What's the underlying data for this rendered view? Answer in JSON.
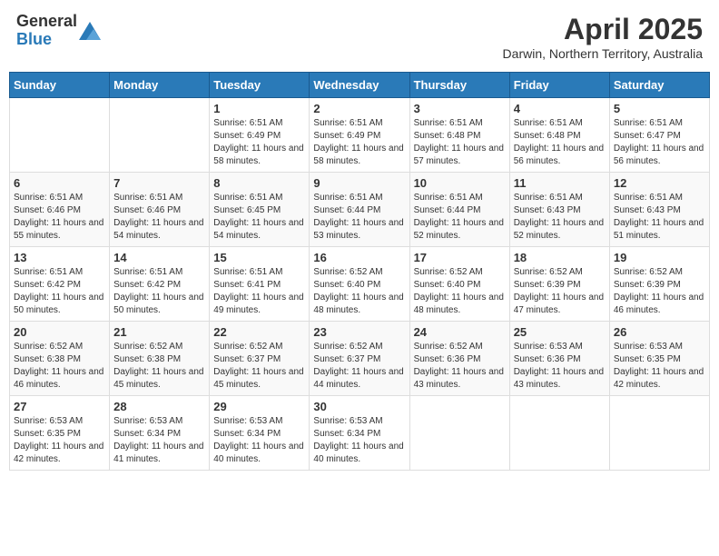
{
  "header": {
    "logo_general": "General",
    "logo_blue": "Blue",
    "title": "April 2025",
    "subtitle": "Darwin, Northern Territory, Australia"
  },
  "calendar": {
    "weekdays": [
      "Sunday",
      "Monday",
      "Tuesday",
      "Wednesday",
      "Thursday",
      "Friday",
      "Saturday"
    ],
    "weeks": [
      [
        {
          "day": "",
          "info": ""
        },
        {
          "day": "",
          "info": ""
        },
        {
          "day": "1",
          "info": "Sunrise: 6:51 AM\nSunset: 6:49 PM\nDaylight: 11 hours and 58 minutes."
        },
        {
          "day": "2",
          "info": "Sunrise: 6:51 AM\nSunset: 6:49 PM\nDaylight: 11 hours and 58 minutes."
        },
        {
          "day": "3",
          "info": "Sunrise: 6:51 AM\nSunset: 6:48 PM\nDaylight: 11 hours and 57 minutes."
        },
        {
          "day": "4",
          "info": "Sunrise: 6:51 AM\nSunset: 6:48 PM\nDaylight: 11 hours and 56 minutes."
        },
        {
          "day": "5",
          "info": "Sunrise: 6:51 AM\nSunset: 6:47 PM\nDaylight: 11 hours and 56 minutes."
        }
      ],
      [
        {
          "day": "6",
          "info": "Sunrise: 6:51 AM\nSunset: 6:46 PM\nDaylight: 11 hours and 55 minutes."
        },
        {
          "day": "7",
          "info": "Sunrise: 6:51 AM\nSunset: 6:46 PM\nDaylight: 11 hours and 54 minutes."
        },
        {
          "day": "8",
          "info": "Sunrise: 6:51 AM\nSunset: 6:45 PM\nDaylight: 11 hours and 54 minutes."
        },
        {
          "day": "9",
          "info": "Sunrise: 6:51 AM\nSunset: 6:44 PM\nDaylight: 11 hours and 53 minutes."
        },
        {
          "day": "10",
          "info": "Sunrise: 6:51 AM\nSunset: 6:44 PM\nDaylight: 11 hours and 52 minutes."
        },
        {
          "day": "11",
          "info": "Sunrise: 6:51 AM\nSunset: 6:43 PM\nDaylight: 11 hours and 52 minutes."
        },
        {
          "day": "12",
          "info": "Sunrise: 6:51 AM\nSunset: 6:43 PM\nDaylight: 11 hours and 51 minutes."
        }
      ],
      [
        {
          "day": "13",
          "info": "Sunrise: 6:51 AM\nSunset: 6:42 PM\nDaylight: 11 hours and 50 minutes."
        },
        {
          "day": "14",
          "info": "Sunrise: 6:51 AM\nSunset: 6:42 PM\nDaylight: 11 hours and 50 minutes."
        },
        {
          "day": "15",
          "info": "Sunrise: 6:51 AM\nSunset: 6:41 PM\nDaylight: 11 hours and 49 minutes."
        },
        {
          "day": "16",
          "info": "Sunrise: 6:52 AM\nSunset: 6:40 PM\nDaylight: 11 hours and 48 minutes."
        },
        {
          "day": "17",
          "info": "Sunrise: 6:52 AM\nSunset: 6:40 PM\nDaylight: 11 hours and 48 minutes."
        },
        {
          "day": "18",
          "info": "Sunrise: 6:52 AM\nSunset: 6:39 PM\nDaylight: 11 hours and 47 minutes."
        },
        {
          "day": "19",
          "info": "Sunrise: 6:52 AM\nSunset: 6:39 PM\nDaylight: 11 hours and 46 minutes."
        }
      ],
      [
        {
          "day": "20",
          "info": "Sunrise: 6:52 AM\nSunset: 6:38 PM\nDaylight: 11 hours and 46 minutes."
        },
        {
          "day": "21",
          "info": "Sunrise: 6:52 AM\nSunset: 6:38 PM\nDaylight: 11 hours and 45 minutes."
        },
        {
          "day": "22",
          "info": "Sunrise: 6:52 AM\nSunset: 6:37 PM\nDaylight: 11 hours and 45 minutes."
        },
        {
          "day": "23",
          "info": "Sunrise: 6:52 AM\nSunset: 6:37 PM\nDaylight: 11 hours and 44 minutes."
        },
        {
          "day": "24",
          "info": "Sunrise: 6:52 AM\nSunset: 6:36 PM\nDaylight: 11 hours and 43 minutes."
        },
        {
          "day": "25",
          "info": "Sunrise: 6:53 AM\nSunset: 6:36 PM\nDaylight: 11 hours and 43 minutes."
        },
        {
          "day": "26",
          "info": "Sunrise: 6:53 AM\nSunset: 6:35 PM\nDaylight: 11 hours and 42 minutes."
        }
      ],
      [
        {
          "day": "27",
          "info": "Sunrise: 6:53 AM\nSunset: 6:35 PM\nDaylight: 11 hours and 42 minutes."
        },
        {
          "day": "28",
          "info": "Sunrise: 6:53 AM\nSunset: 6:34 PM\nDaylight: 11 hours and 41 minutes."
        },
        {
          "day": "29",
          "info": "Sunrise: 6:53 AM\nSunset: 6:34 PM\nDaylight: 11 hours and 40 minutes."
        },
        {
          "day": "30",
          "info": "Sunrise: 6:53 AM\nSunset: 6:34 PM\nDaylight: 11 hours and 40 minutes."
        },
        {
          "day": "",
          "info": ""
        },
        {
          "day": "",
          "info": ""
        },
        {
          "day": "",
          "info": ""
        }
      ]
    ]
  }
}
